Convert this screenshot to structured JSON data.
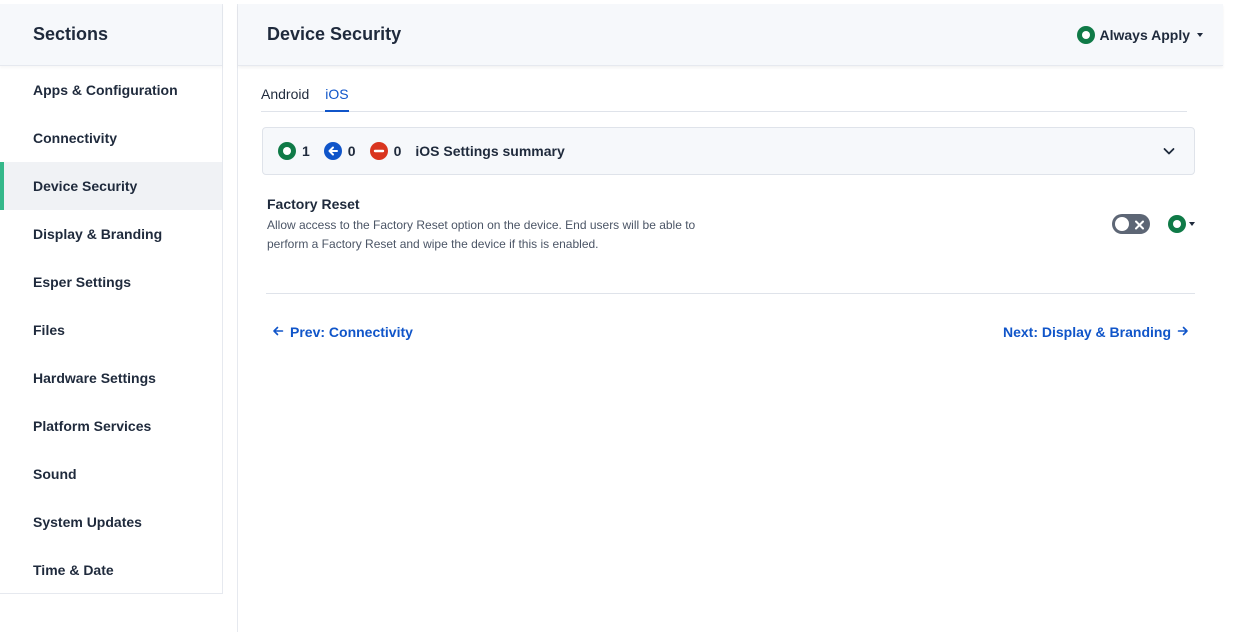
{
  "sidebar": {
    "title": "Sections",
    "items": [
      {
        "label": "Apps & Configuration"
      },
      {
        "label": "Connectivity"
      },
      {
        "label": "Device Security",
        "active": true
      },
      {
        "label": "Display & Branding"
      },
      {
        "label": "Esper Settings"
      },
      {
        "label": "Files"
      },
      {
        "label": "Hardware Settings"
      },
      {
        "label": "Platform Services"
      },
      {
        "label": "Sound"
      },
      {
        "label": "System Updates"
      },
      {
        "label": "Time & Date"
      }
    ]
  },
  "header": {
    "title": "Device Security",
    "apply_mode": "Always Apply"
  },
  "tabs": [
    {
      "label": "Android"
    },
    {
      "label": "iOS",
      "active": true
    }
  ],
  "summary": {
    "apply_count": "1",
    "pull_count": "0",
    "blocked_count": "0",
    "title": "iOS Settings summary"
  },
  "setting": {
    "title": "Factory Reset",
    "description": "Allow access to the Factory Reset option on the device. End users will be able to perform a Factory Reset and wipe the device if this is enabled."
  },
  "nav": {
    "prev_label": "Prev: Connectivity",
    "next_label": "Next: Display & Branding"
  },
  "colors": {
    "accent_green": "#35b88a",
    "apply_green": "#0f7a47",
    "link_blue": "#1055c9",
    "blocked_red": "#d9351f"
  }
}
